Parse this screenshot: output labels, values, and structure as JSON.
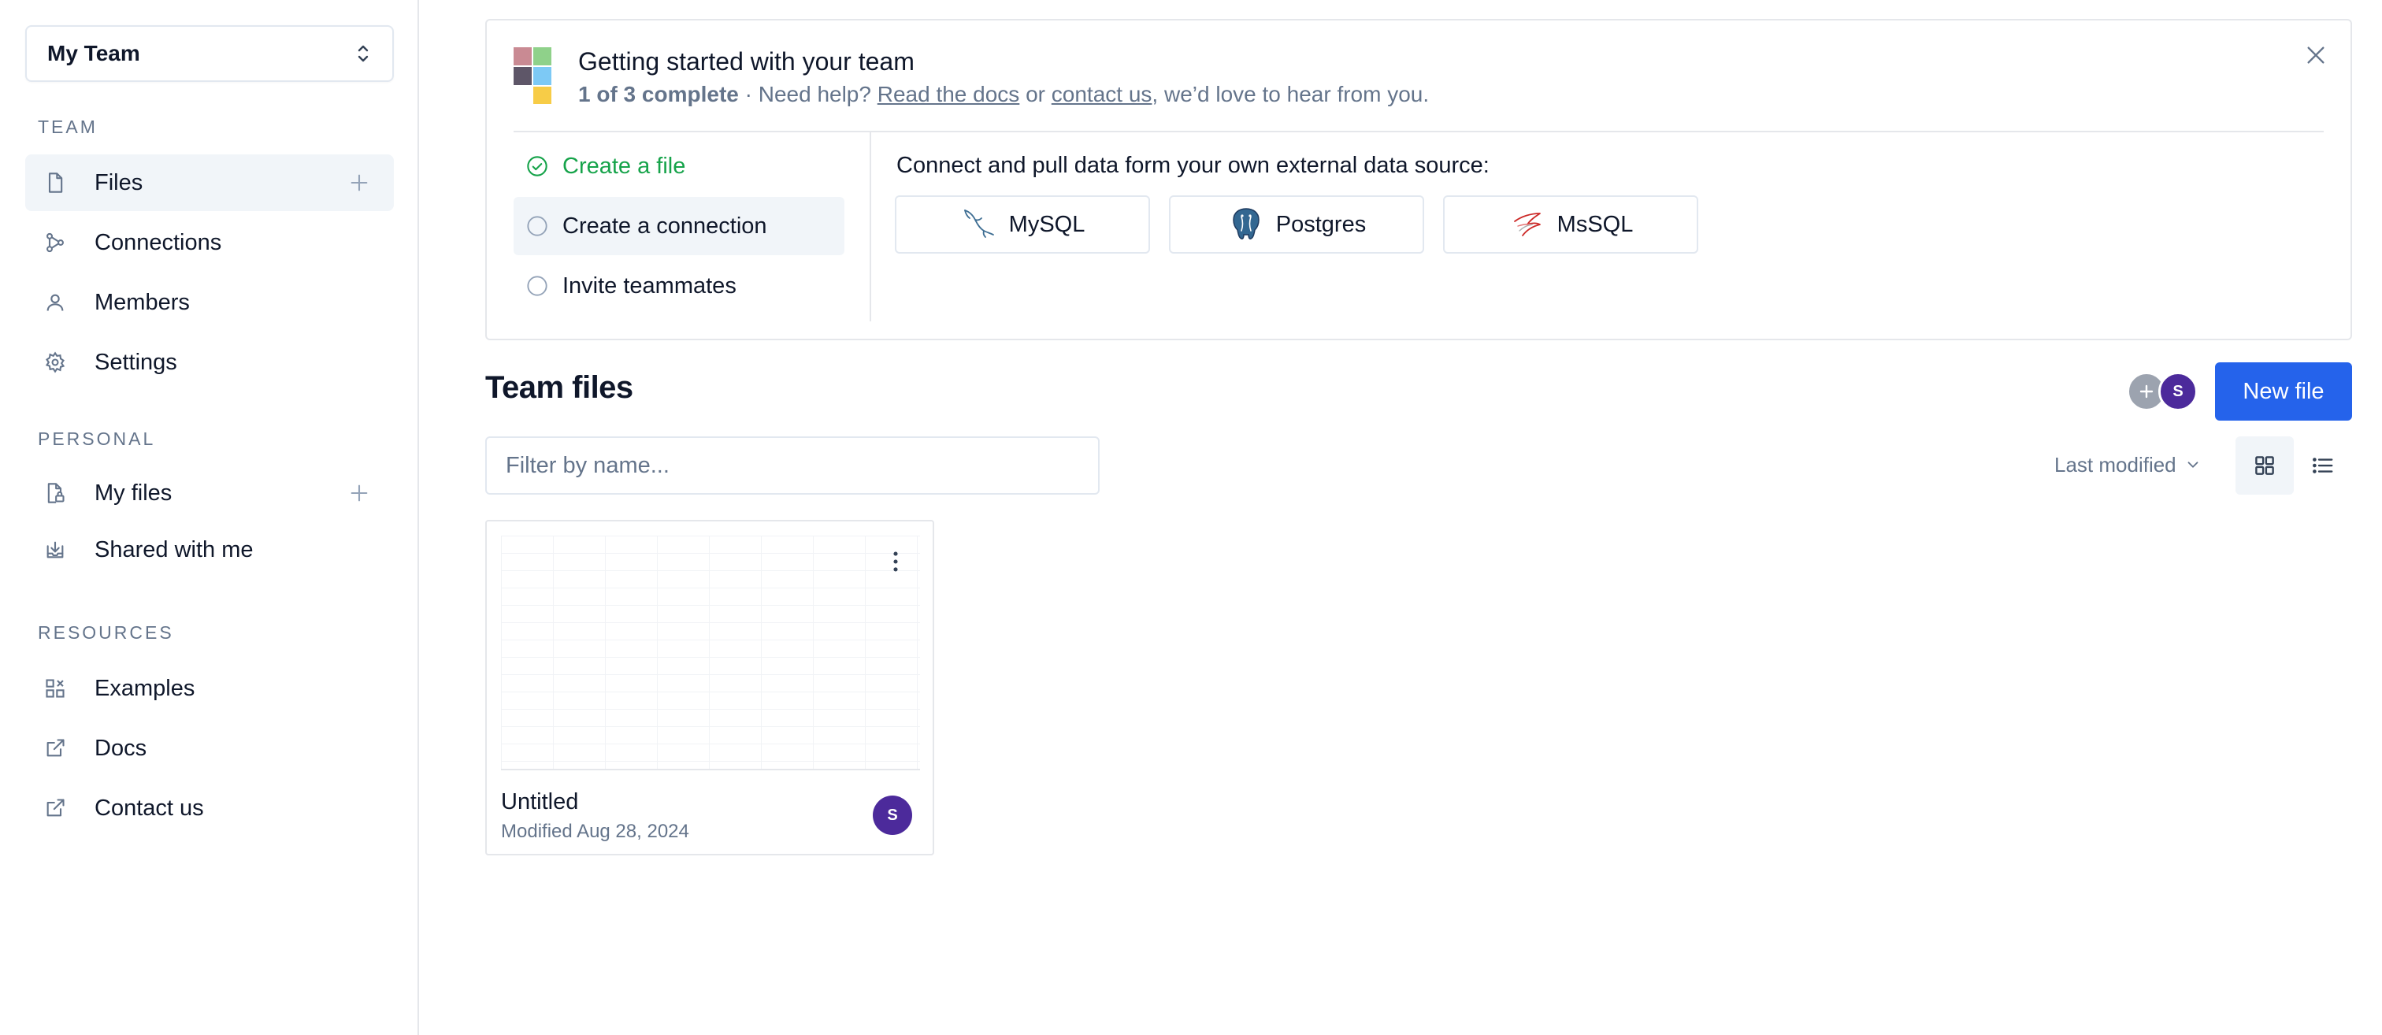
{
  "sidebar": {
    "team_switcher": {
      "label": "My Team"
    },
    "sections": {
      "team": "TEAM",
      "personal": "PERSONAL",
      "resources": "RESOURCES"
    },
    "team_items": [
      {
        "label": "Files",
        "icon": "file-icon",
        "active": true
      },
      {
        "label": "Connections",
        "icon": "connections-icon"
      },
      {
        "label": "Members",
        "icon": "user-icon"
      },
      {
        "label": "Settings",
        "icon": "gear-icon"
      }
    ],
    "personal_items": [
      {
        "label": "My files",
        "icon": "file-lock-icon"
      },
      {
        "label": "Shared with me",
        "icon": "inbox-download-icon"
      }
    ],
    "resource_items": [
      {
        "label": "Examples",
        "icon": "examples-icon"
      },
      {
        "label": "Docs",
        "icon": "external-link-icon"
      },
      {
        "label": "Contact us",
        "icon": "external-link-icon"
      }
    ]
  },
  "onboarding": {
    "title": "Getting started with your team",
    "progress": "1 of 3 complete",
    "help_prefix": " · Need help? ",
    "docs_link": "Read the docs",
    "or_text": " or ",
    "contact_link": "contact us",
    "help_suffix": ", we’d love to hear from you.",
    "steps": [
      {
        "label": "Create a file",
        "status": "done"
      },
      {
        "label": "Create a connection",
        "status": "current"
      },
      {
        "label": "Invite teammates",
        "status": "pending"
      }
    ],
    "connect_title": "Connect and pull data form your own external data source:",
    "sources": [
      {
        "label": "MySQL",
        "icon": "mysql-dolphin-icon"
      },
      {
        "label": "Postgres",
        "icon": "postgres-elephant-icon"
      },
      {
        "label": "MsSQL",
        "icon": "mssql-icon"
      }
    ],
    "logo_colors": [
      "#c98a93",
      "#8fd18a",
      "#5e5668",
      "#7dc9f5",
      "#f7cc47"
    ]
  },
  "team_files": {
    "title": "Team files",
    "avatar_initial": "S",
    "new_file_label": "New file",
    "filter_placeholder": "Filter by name...",
    "sort_label": "Last modified",
    "files": [
      {
        "name": "Untitled",
        "modified_prefix": "Modified ",
        "modified_date": "Aug 28, 2024",
        "owner_initial": "S"
      }
    ]
  },
  "colors": {
    "accent": "#2563eb",
    "success": "#16a34a",
    "avatar": "#4c2a9b",
    "muted_text": "#64748b"
  }
}
